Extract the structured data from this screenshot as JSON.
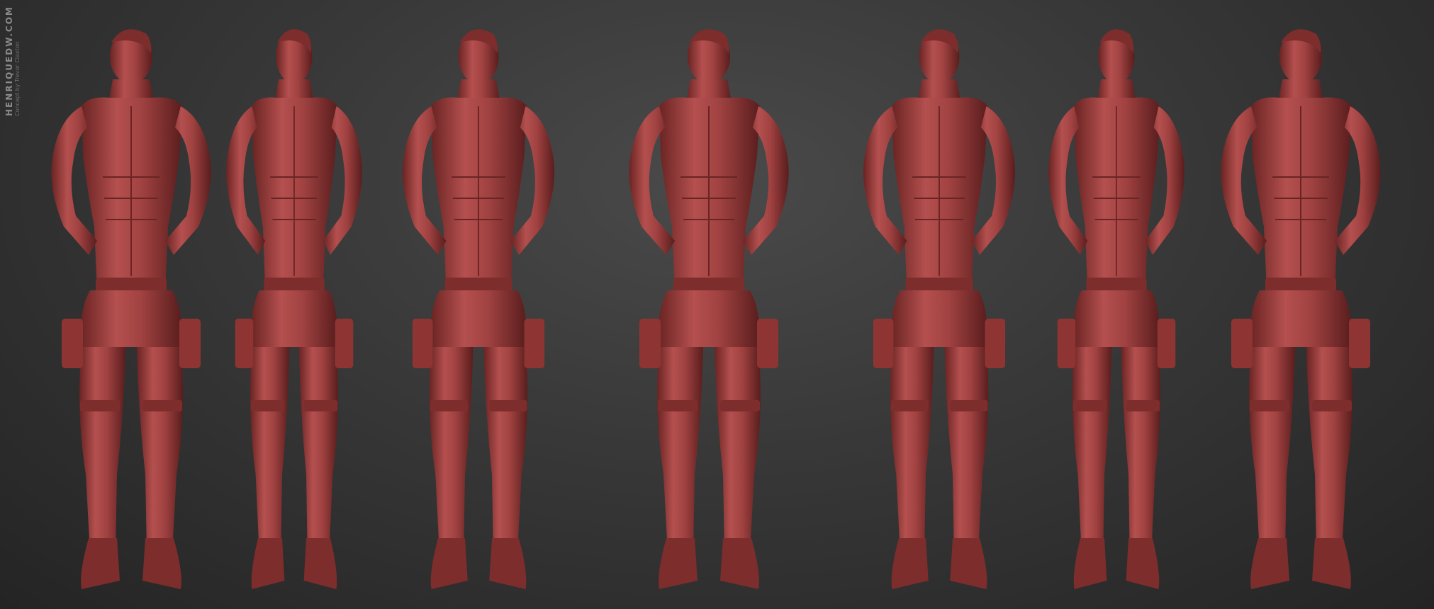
{
  "watermark": {
    "site": "HENRIQUEDW.COM",
    "credit": "Concept by Trevor Claxton"
  },
  "turnaround": {
    "views": [
      "back",
      "left-side",
      "front-three-quarter-left",
      "front",
      "front-three-quarter-right",
      "right-side",
      "back-right"
    ]
  },
  "colors": {
    "background_center": "#4a4a4a",
    "background_edge": "#242424",
    "clay_light": "#b4504f",
    "clay_mid": "#8e3534",
    "clay_dark": "#5a1d1d"
  }
}
